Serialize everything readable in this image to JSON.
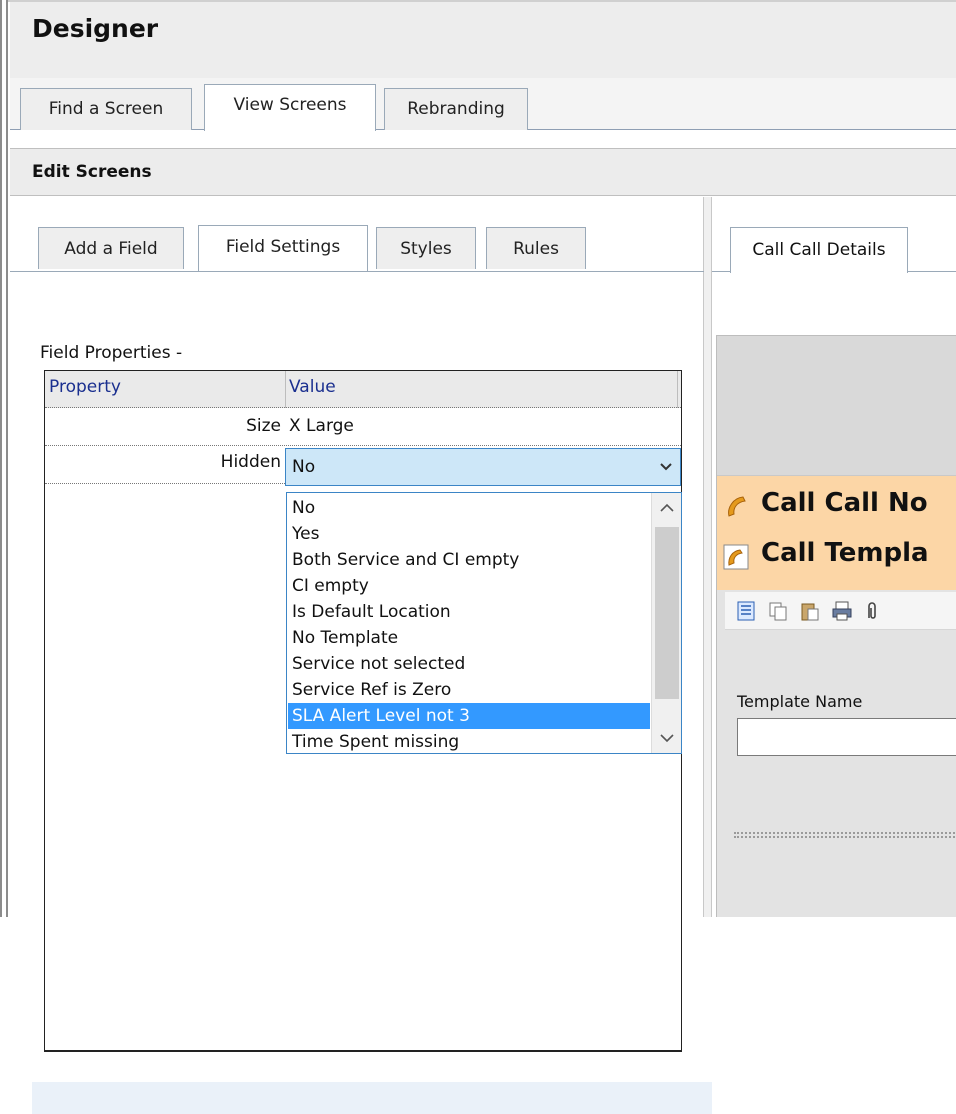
{
  "app": {
    "title": "Designer"
  },
  "main_tabs": [
    {
      "label": "Find a Screen",
      "active": false
    },
    {
      "label": "View Screens",
      "active": true
    },
    {
      "label": "Rebranding",
      "active": false
    }
  ],
  "edit_screens": {
    "title": "Edit Screens"
  },
  "sub_tabs": [
    {
      "label": "Add a Field",
      "active": false
    },
    {
      "label": "Field Settings",
      "active": true
    },
    {
      "label": "Styles",
      "active": false
    },
    {
      "label": "Rules",
      "active": false
    }
  ],
  "field_properties": {
    "label": "Field Properties -",
    "headers": {
      "property": "Property",
      "value": "Value"
    },
    "rows": [
      {
        "name": "Size",
        "value": "X Large"
      },
      {
        "name": "Hidden",
        "value": "No"
      }
    ]
  },
  "hidden_dropdown": {
    "selected_display": "No",
    "highlighted": "SLA Alert Level not 3",
    "options": [
      "No",
      "Yes",
      "Both Service and CI empty",
      "CI empty",
      "Is Default Location",
      "No Template",
      "Service not selected",
      "Service Ref is Zero",
      "SLA Alert Level not 3",
      "Time Spent missing"
    ]
  },
  "preview": {
    "tab_label": "Call Call Details",
    "lines": [
      "Call Call No",
      "Call Templa"
    ],
    "template_name_label": "Template Name",
    "template_name_value": ""
  },
  "colors": {
    "accent_blue": "#3399ff",
    "select_bg": "#cde7f8",
    "orange_band": "#fcd6a6"
  }
}
